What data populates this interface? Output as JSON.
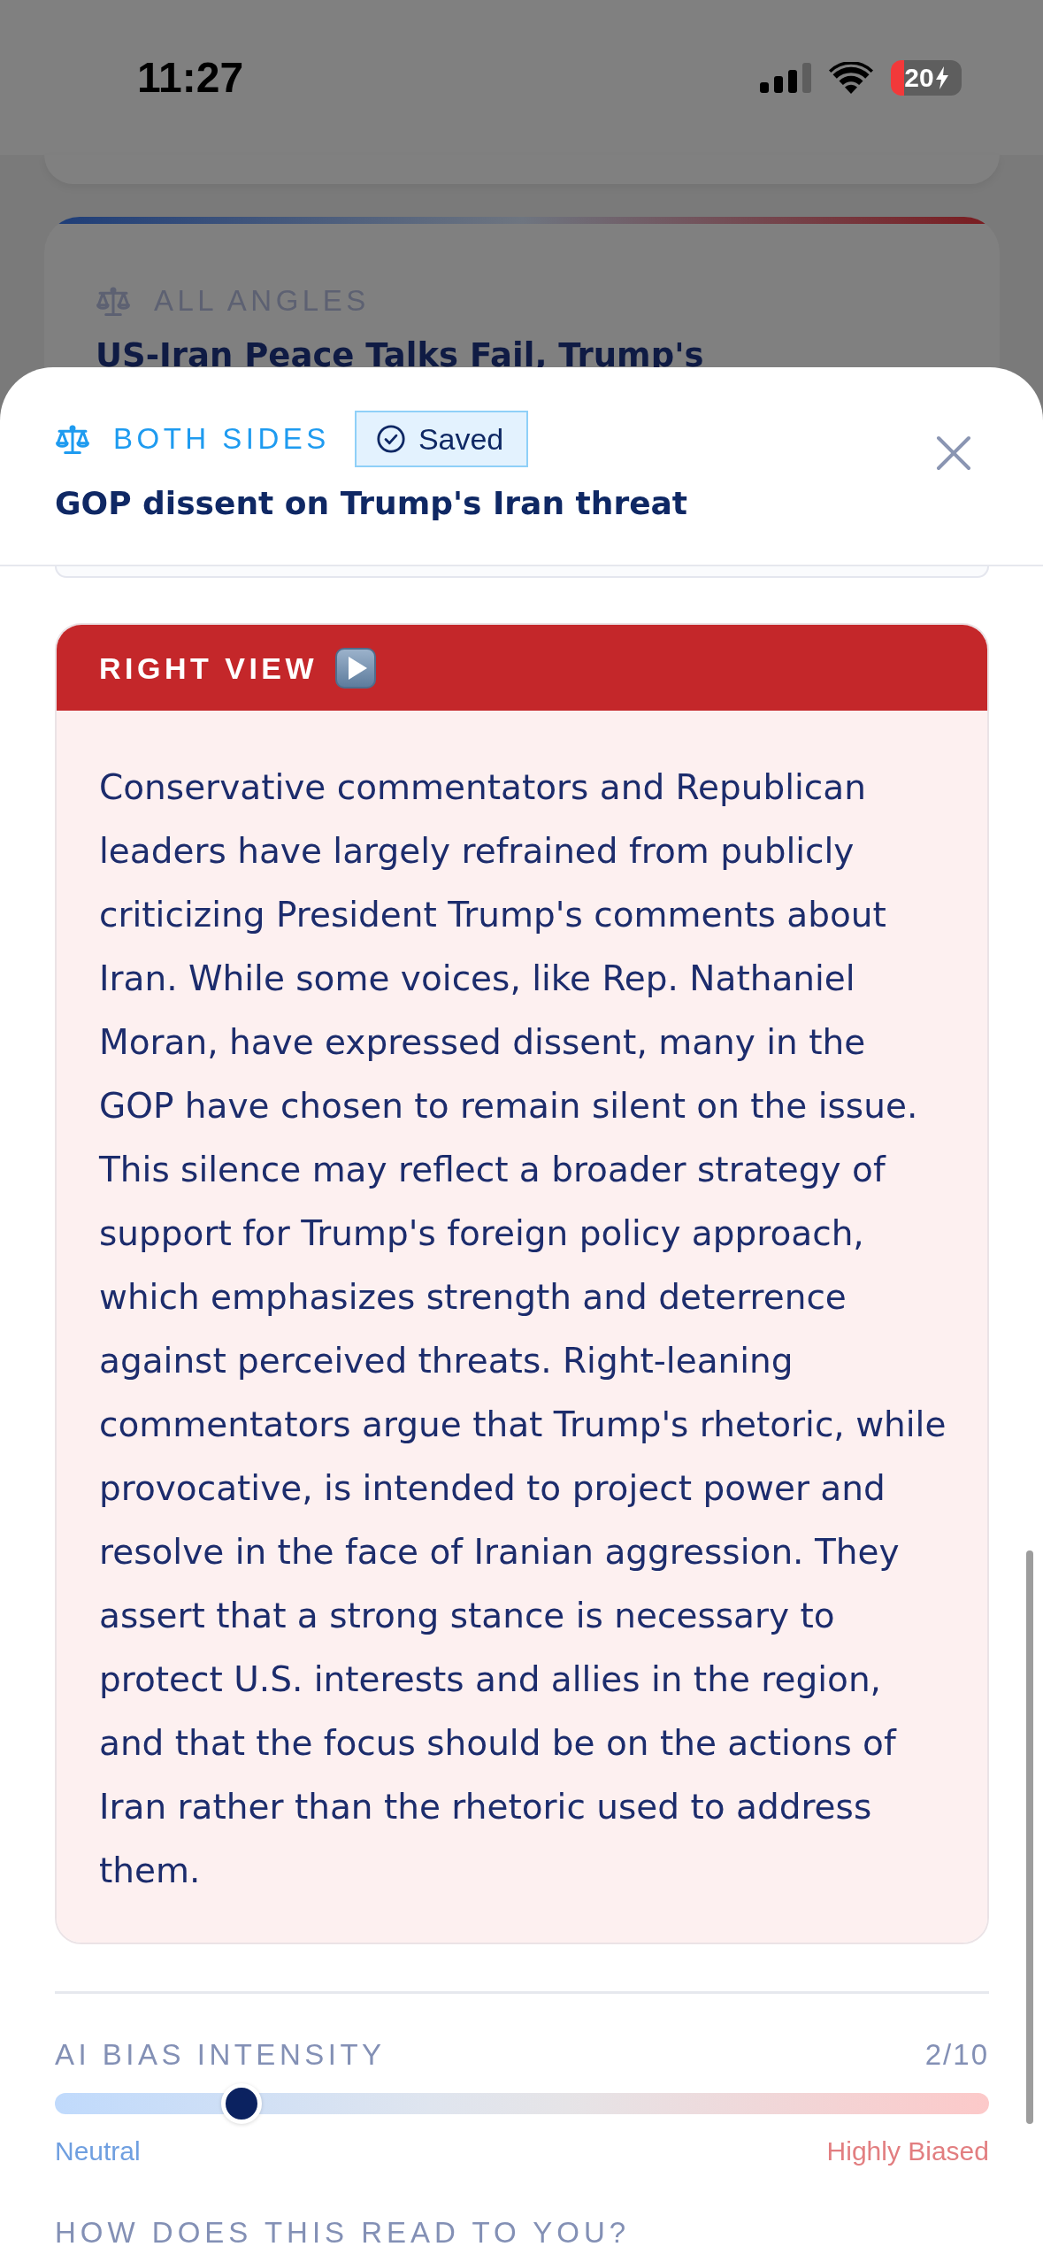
{
  "status_bar": {
    "time": "11:27",
    "battery": "20"
  },
  "background_card": {
    "label": "ALL ANGLES",
    "title": "US-Iran Peace Talks Fail, Trump's"
  },
  "sheet": {
    "category": "BOTH SIDES",
    "saved_badge": "Saved",
    "title": "GOP dissent on Trump's Iran threat",
    "view": {
      "kind": "right",
      "heading": "RIGHT VIEW",
      "text": "Conservative commentators and Republican leaders have largely refrained from publicly criticizing President Trump's comments about Iran. While some voices, like Rep. Nathaniel Moran, have expressed dissent, many in the GOP have chosen to remain silent on the issue. This silence may reflect a broader strategy of support for Trump's foreign policy approach, which emphasizes strength and deterrence against perceived threats. Right-leaning commentators argue that Trump's rhetoric, while provocative, is intended to project power and resolve in the face of Iranian aggression. They assert that a strong stance is necessary to protect U.S. interests and allies in the region, and that the focus should be on the actions of Iran rather than the rhetoric used to address them."
    },
    "bias": {
      "label": "AI BIAS INTENSITY",
      "score": "2/10",
      "level": 0.2,
      "min_label": "Neutral",
      "max_label": "Highly Biased"
    },
    "question": "HOW DOES THIS READ TO YOU?"
  }
}
